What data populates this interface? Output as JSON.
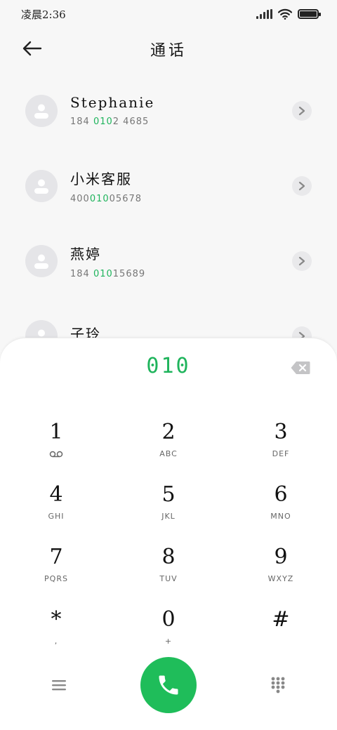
{
  "status": {
    "time": "凌晨2:36"
  },
  "header": {
    "title": "通话"
  },
  "contacts": [
    {
      "name": "Stephanie",
      "number_pre": "184 ",
      "number_hl": "010",
      "number_post": "2 4685"
    },
    {
      "name": "小米客服",
      "number_pre": "400",
      "number_hl": "010",
      "number_post": "05678"
    },
    {
      "name": "燕婷",
      "number_pre": "184 ",
      "number_hl": "010",
      "number_post": "15689"
    },
    {
      "name": "子玲",
      "number_pre": "",
      "number_hl": "",
      "number_post": ""
    }
  ],
  "dialpad": {
    "input": "010",
    "keys": [
      {
        "digit": "1",
        "sub": ""
      },
      {
        "digit": "2",
        "sub": "ABC"
      },
      {
        "digit": "3",
        "sub": "DEF"
      },
      {
        "digit": "4",
        "sub": "GHI"
      },
      {
        "digit": "5",
        "sub": "JKL"
      },
      {
        "digit": "6",
        "sub": "MNO"
      },
      {
        "digit": "7",
        "sub": "PQRS"
      },
      {
        "digit": "8",
        "sub": "TUV"
      },
      {
        "digit": "9",
        "sub": "WXYZ"
      },
      {
        "digit": "*",
        "sub": ","
      },
      {
        "digit": "0",
        "sub": "+"
      },
      {
        "digit": "#",
        "sub": ""
      }
    ]
  },
  "colors": {
    "accent": "#1fb45c",
    "call_button": "#1fbd5a"
  },
  "icons": {
    "back": "arrow-left-icon",
    "voicemail": "voicemail-icon",
    "backspace": "backspace-icon",
    "menu": "menu-icon",
    "call": "phone-icon",
    "dialpad": "dialpad-icon"
  }
}
